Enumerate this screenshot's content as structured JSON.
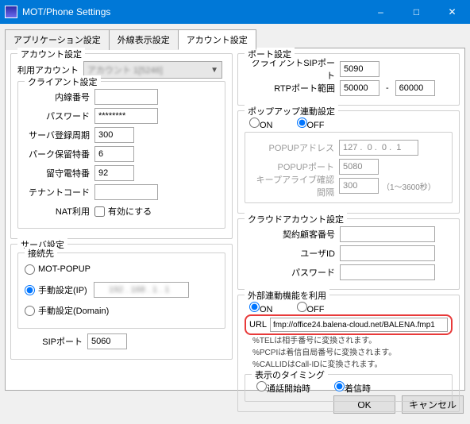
{
  "window": {
    "title": "MOT/Phone Settings"
  },
  "tabs": {
    "t1": "アプリケーション設定",
    "t2": "外線表示設定",
    "t3": "アカウント設定"
  },
  "left": {
    "account_group": "アカウント設定",
    "account_label": "利用アカウント",
    "account_value": "アカウント 1[5246]",
    "client_group": "クライアント設定",
    "ext_label": "内線番号",
    "ext_value": "",
    "pw_label": "パスワード",
    "pw_value": "********",
    "reg_label": "サーバ登録周期",
    "reg_value": "300",
    "park_label": "パーク保留特番",
    "park_value": "6",
    "voicemail_label": "留守電特番",
    "voicemail_value": "92",
    "tenant_label": "テナントコード",
    "tenant_value": "",
    "nat_label": "NAT利用",
    "nat_check": "有効にする",
    "server_group": "サーバ設定",
    "dest_group": "接続先",
    "opt_mot": "MOT-POPUP",
    "opt_manual_ip": "手動設定(IP)",
    "manual_ip_value": "192 . 168 .  1 .  1",
    "opt_manual_domain": "手動設定(Domain)",
    "sip_port_label": "SIPポート",
    "sip_port_value": "5060"
  },
  "right": {
    "port_group": "ポート設定",
    "client_sip_label": "クライアントSIPポート",
    "client_sip_value": "5090",
    "rtp_label": "RTPポート範囲",
    "rtp_lo": "50000",
    "rtp_hi": "60000",
    "popup_group": "ポップアップ連動設定",
    "on": "ON",
    "off": "OFF",
    "popup_addr_label": "POPUPアドレス",
    "popup_addr_value": "127 .  0 .  0 .  1",
    "popup_port_label": "POPUPポート",
    "popup_port_value": "5080",
    "keepalive_label": "キープアライブ確認間隔",
    "keepalive_value": "300",
    "keepalive_hint": "（1～3600秒）",
    "cloud_group": "クラウドアカウント設定",
    "cloud_customer": "契約顧客番号",
    "cloud_user": "ユーザID",
    "cloud_pw": "パスワード",
    "ext_group": "外部連動機能を利用",
    "url_label": "URL",
    "url_value": "fmp://office24.balena-cloud.net/BALENA.fmp1",
    "note1": "%TELは相手番号に変換されます。",
    "note2": "%PCPIは着信自局番号に変換されます。",
    "note3": "%CALLIDはCall-IDに変換されます。",
    "timing_group": "表示のタイミング",
    "timing_start": "通話開始時",
    "timing_ring": "着信時"
  },
  "buttons": {
    "ok": "OK",
    "cancel": "キャンセル"
  }
}
